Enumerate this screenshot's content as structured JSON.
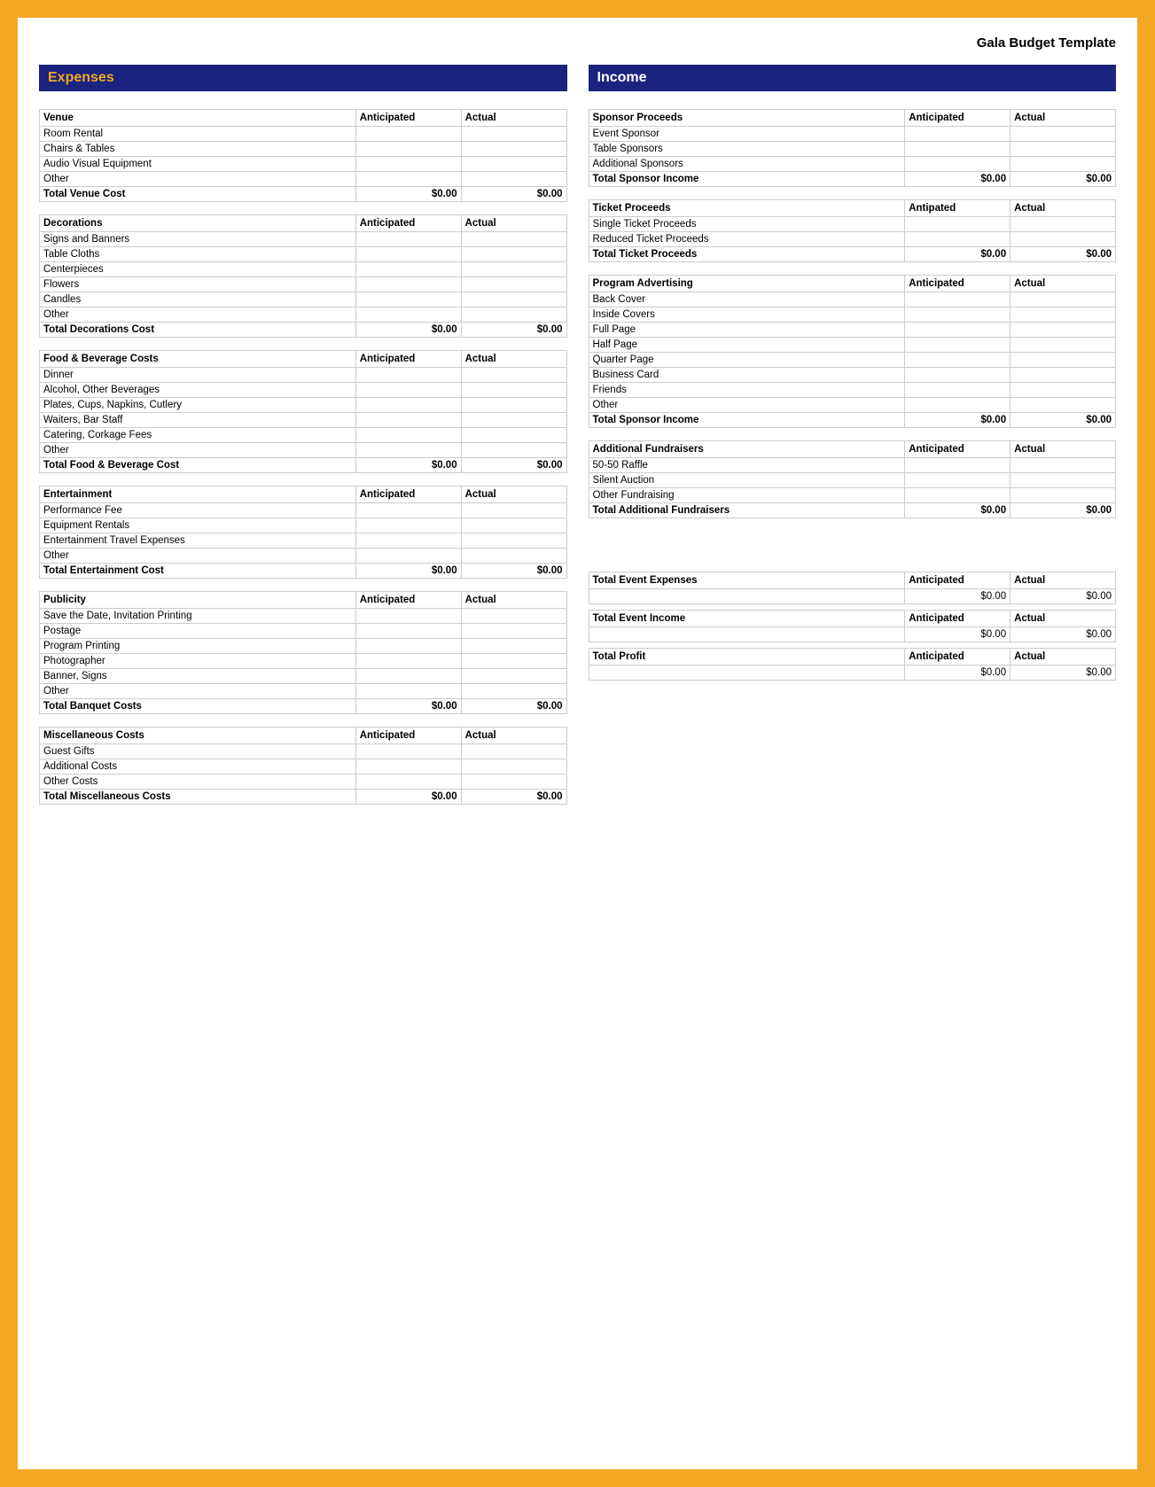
{
  "page": {
    "title": "Gala Budget Template",
    "border_color": "#f5a623"
  },
  "expenses": {
    "header": "Expenses",
    "venue": {
      "label": "Venue",
      "anticipated_col": "Anticipated",
      "actual_col": "Actual",
      "rows": [
        {
          "name": "Room Rental",
          "anticipated": "",
          "actual": ""
        },
        {
          "name": "Chairs & Tables",
          "anticipated": "",
          "actual": ""
        },
        {
          "name": "Audio Visual Equipment",
          "anticipated": "",
          "actual": ""
        },
        {
          "name": "Other",
          "anticipated": "",
          "actual": ""
        }
      ],
      "total_label": "Total Venue Cost",
      "total_anticipated": "$0.00",
      "total_actual": "$0.00"
    },
    "decorations": {
      "label": "Decorations",
      "anticipated_col": "Anticipated",
      "actual_col": "Actual",
      "rows": [
        {
          "name": "Signs and Banners",
          "anticipated": "",
          "actual": ""
        },
        {
          "name": "Table Cloths",
          "anticipated": "",
          "actual": ""
        },
        {
          "name": "Centerpieces",
          "anticipated": "",
          "actual": ""
        },
        {
          "name": "Flowers",
          "anticipated": "",
          "actual": ""
        },
        {
          "name": "Candles",
          "anticipated": "",
          "actual": ""
        },
        {
          "name": "Other",
          "anticipated": "",
          "actual": ""
        }
      ],
      "total_label": "Total Decorations Cost",
      "total_anticipated": "$0.00",
      "total_actual": "$0.00"
    },
    "food_beverage": {
      "label": "Food & Beverage Costs",
      "anticipated_col": "Anticipated",
      "actual_col": "Actual",
      "rows": [
        {
          "name": "Dinner",
          "anticipated": "",
          "actual": ""
        },
        {
          "name": "Alcohol, Other Beverages",
          "anticipated": "",
          "actual": ""
        },
        {
          "name": "Plates, Cups, Napkins, Cutlery",
          "anticipated": "",
          "actual": ""
        },
        {
          "name": "Waiters, Bar Staff",
          "anticipated": "",
          "actual": ""
        },
        {
          "name": "Catering, Corkage Fees",
          "anticipated": "",
          "actual": ""
        },
        {
          "name": "Other",
          "anticipated": "",
          "actual": ""
        }
      ],
      "total_label": "Total Food & Beverage Cost",
      "total_anticipated": "$0.00",
      "total_actual": "$0.00"
    },
    "entertainment": {
      "label": "Entertainment",
      "anticipated_col": "Anticipated",
      "actual_col": "Actual",
      "rows": [
        {
          "name": "Performance Fee",
          "anticipated": "",
          "actual": ""
        },
        {
          "name": "Equipment Rentals",
          "anticipated": "",
          "actual": ""
        },
        {
          "name": "Entertainment Travel Expenses",
          "anticipated": "",
          "actual": ""
        },
        {
          "name": "Other",
          "anticipated": "",
          "actual": ""
        }
      ],
      "total_label": "Total Entertainment Cost",
      "total_anticipated": "$0.00",
      "total_actual": "$0.00"
    },
    "publicity": {
      "label": "Publicity",
      "anticipated_col": "Anticipated",
      "actual_col": "Actual",
      "rows": [
        {
          "name": "Save the Date, Invitation Printing",
          "anticipated": "",
          "actual": ""
        },
        {
          "name": "Postage",
          "anticipated": "",
          "actual": ""
        },
        {
          "name": "Program Printing",
          "anticipated": "",
          "actual": ""
        },
        {
          "name": "Photographer",
          "anticipated": "",
          "actual": ""
        },
        {
          "name": "Banner, Signs",
          "anticipated": "",
          "actual": ""
        },
        {
          "name": "Other",
          "anticipated": "",
          "actual": ""
        }
      ],
      "total_label": "Total Banquet Costs",
      "total_anticipated": "$0.00",
      "total_actual": "$0.00"
    },
    "miscellaneous": {
      "label": "Miscellaneous Costs",
      "anticipated_col": "Anticipated",
      "actual_col": "Actual",
      "rows": [
        {
          "name": "Guest Gifts",
          "anticipated": "",
          "actual": ""
        },
        {
          "name": "Additional Costs",
          "anticipated": "",
          "actual": ""
        },
        {
          "name": "Other Costs",
          "anticipated": "",
          "actual": ""
        }
      ],
      "total_label": "Total Miscellaneous Costs",
      "total_anticipated": "$0.00",
      "total_actual": "$0.00"
    }
  },
  "income": {
    "header": "Income",
    "sponsor": {
      "label": "Sponsor Proceeds",
      "anticipated_col": "Anticipated",
      "actual_col": "Actual",
      "rows": [
        {
          "name": "Event Sponsor",
          "anticipated": "",
          "actual": ""
        },
        {
          "name": "Table Sponsors",
          "anticipated": "",
          "actual": ""
        },
        {
          "name": "Additional Sponsors",
          "anticipated": "",
          "actual": ""
        }
      ],
      "total_label": "Total Sponsor Income",
      "total_anticipated": "$0.00",
      "total_actual": "$0.00"
    },
    "ticket": {
      "label": "Ticket Proceeds",
      "anticipated_col": "Antipated",
      "actual_col": "Actual",
      "rows": [
        {
          "name": "Single Ticket Proceeds",
          "anticipated": "",
          "actual": ""
        },
        {
          "name": "Reduced Ticket Proceeds",
          "anticipated": "",
          "actual": ""
        }
      ],
      "total_label": "Total Ticket Proceeds",
      "total_anticipated": "$0.00",
      "total_actual": "$0.00"
    },
    "program_advertising": {
      "label": "Program Advertising",
      "anticipated_col": "Anticipated",
      "actual_col": "Actual",
      "rows": [
        {
          "name": "Back Cover",
          "anticipated": "",
          "actual": ""
        },
        {
          "name": "Inside Covers",
          "anticipated": "",
          "actual": ""
        },
        {
          "name": "Full Page",
          "anticipated": "",
          "actual": ""
        },
        {
          "name": "Half Page",
          "anticipated": "",
          "actual": ""
        },
        {
          "name": "Quarter Page",
          "anticipated": "",
          "actual": ""
        },
        {
          "name": "Business Card",
          "anticipated": "",
          "actual": ""
        },
        {
          "name": "Friends",
          "anticipated": "",
          "actual": ""
        },
        {
          "name": "Other",
          "anticipated": "",
          "actual": ""
        }
      ],
      "total_label": "Total Sponsor Income",
      "total_anticipated": "$0.00",
      "total_actual": "$0.00"
    },
    "additional_fundraisers": {
      "label": "Additional Fundraisers",
      "anticipated_col": "Anticipated",
      "actual_col": "Actual",
      "rows": [
        {
          "name": "50-50 Raffle",
          "anticipated": "",
          "actual": ""
        },
        {
          "name": "Silent Auction",
          "anticipated": "",
          "actual": ""
        },
        {
          "name": "Other Fundraising",
          "anticipated": "",
          "actual": ""
        }
      ],
      "total_label": "Total Additional Fundraisers",
      "total_anticipated": "$0.00",
      "total_actual": "$0.00"
    }
  },
  "summary": {
    "total_event_expenses": {
      "label": "Total Event Expenses",
      "anticipated_col": "Anticipated",
      "actual_col": "Actual",
      "anticipated_val": "$0.00",
      "actual_val": "$0.00"
    },
    "total_event_income": {
      "label": "Total Event Income",
      "anticipated_col": "Anticipated",
      "actual_col": "Actual",
      "anticipated_val": "$0.00",
      "actual_val": "$0.00"
    },
    "total_profit": {
      "label": "Total Profit",
      "anticipated_col": "Anticipated",
      "actual_col": "Actual",
      "anticipated_val": "$0.00",
      "actual_val": "$0.00"
    }
  }
}
